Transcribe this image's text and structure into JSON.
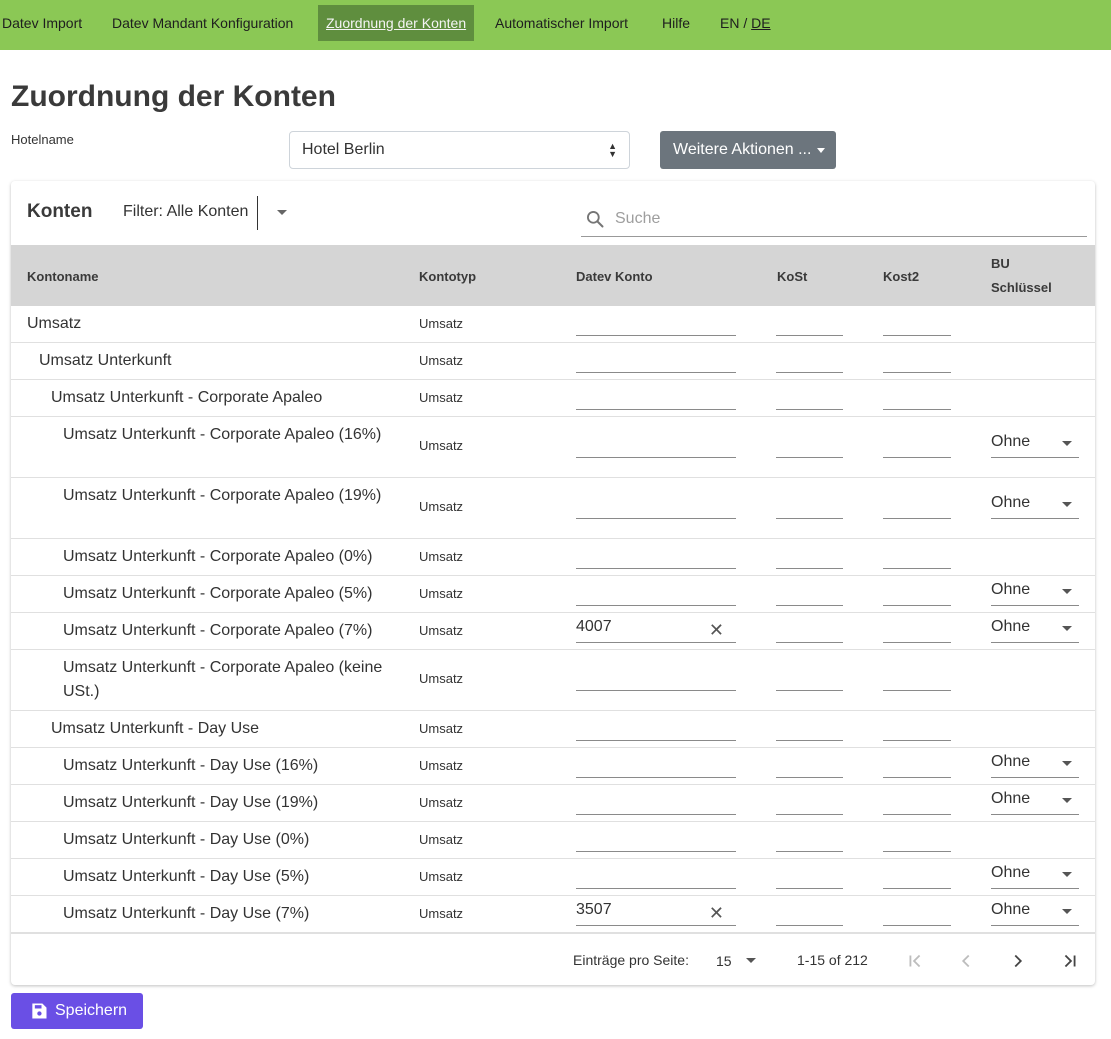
{
  "nav": {
    "items": [
      {
        "label": "Datev Import"
      },
      {
        "label": "Datev Mandant Konfiguration"
      },
      {
        "label": "Zuordnung der Konten"
      },
      {
        "label": "Automatischer Import"
      },
      {
        "label": "Hilfe"
      }
    ],
    "active_index": 2,
    "lang_en": "EN",
    "lang_sep": " / ",
    "lang_de": "DE"
  },
  "page": {
    "title": "Zuordnung der Konten",
    "hotel_label": "Hotelname",
    "hotel_value": "Hotel Berlin",
    "more_actions": "Weitere Aktionen ..."
  },
  "card": {
    "title": "Konten",
    "filter": "Filter: Alle Konten",
    "search_placeholder": "Suche",
    "columns": {
      "name": "Kontoname",
      "type": "Kontotyp",
      "datev": "Datev Konto",
      "kost": "KoSt",
      "kost2": "Kost2",
      "bu_line1": "BU",
      "bu_line2": "Schlüssel"
    }
  },
  "rows": [
    {
      "name": "Umsatz",
      "type": "Umsatz",
      "datev": "",
      "bu": ""
    },
    {
      "name": "Umsatz Unterkunft",
      "type": "Umsatz",
      "datev": "",
      "bu": ""
    },
    {
      "name": "Umsatz Unterkunft - Corporate Apaleo",
      "type": "Umsatz",
      "datev": "",
      "bu": ""
    },
    {
      "name": "Umsatz Unterkunft - Corporate Apaleo (16%)",
      "type": "Umsatz",
      "datev": "",
      "bu": "Ohne"
    },
    {
      "name": "Umsatz Unterkunft - Corporate Apaleo (19%)",
      "type": "Umsatz",
      "datev": "",
      "bu": "Ohne"
    },
    {
      "name": "Umsatz Unterkunft - Corporate Apaleo (0%)",
      "type": "Umsatz",
      "datev": "",
      "bu": ""
    },
    {
      "name": "Umsatz Unterkunft - Corporate Apaleo (5%)",
      "type": "Umsatz",
      "datev": "",
      "bu": "Ohne"
    },
    {
      "name": "Umsatz Unterkunft - Corporate Apaleo (7%)",
      "type": "Umsatz",
      "datev": "4007",
      "bu": "Ohne"
    },
    {
      "name": "Umsatz Unterkunft - Corporate Apaleo (keine USt.)",
      "type": "Umsatz",
      "datev": "",
      "bu": ""
    },
    {
      "name": "Umsatz Unterkunft - Day Use",
      "type": "Umsatz",
      "datev": "",
      "bu": ""
    },
    {
      "name": "Umsatz Unterkunft - Day Use (16%)",
      "type": "Umsatz",
      "datev": "",
      "bu": "Ohne"
    },
    {
      "name": "Umsatz Unterkunft - Day Use (19%)",
      "type": "Umsatz",
      "datev": "",
      "bu": "Ohne"
    },
    {
      "name": "Umsatz Unterkunft - Day Use (0%)",
      "type": "Umsatz",
      "datev": "",
      "bu": ""
    },
    {
      "name": "Umsatz Unterkunft - Day Use (5%)",
      "type": "Umsatz",
      "datev": "",
      "bu": "Ohne"
    },
    {
      "name": "Umsatz Unterkunft - Day Use (7%)",
      "type": "Umsatz",
      "datev": "3507",
      "bu": "Ohne"
    }
  ],
  "pagination": {
    "per_page_label": "Einträge pro Seite:",
    "per_page": "15",
    "range": "1-15 of 212"
  },
  "save_label": "Speichern"
}
